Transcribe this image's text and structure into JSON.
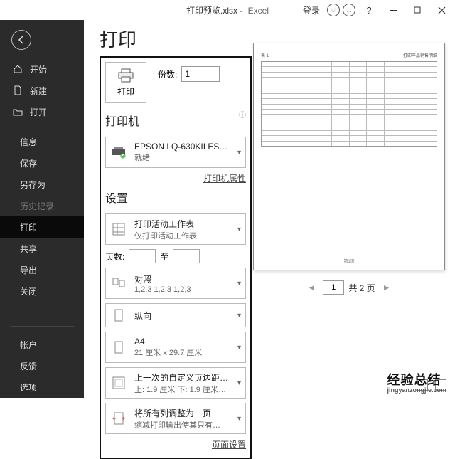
{
  "titlebar": {
    "filename": "打印预览.xlsx",
    "sep": " - ",
    "app": "Excel",
    "login": "登录"
  },
  "sidebar": {
    "home": "开始",
    "new": "新建",
    "open": "打开",
    "info": "信息",
    "save": "保存",
    "saveas": "另存为",
    "history": "历史记录",
    "print": "打印",
    "share": "共享",
    "export": "导出",
    "close": "关闭",
    "account": "帐户",
    "feedback": "反馈",
    "options": "选项"
  },
  "page": {
    "title": "打印"
  },
  "printbtn": {
    "label": "打印",
    "copies_label": "份数:",
    "copies_value": "1"
  },
  "printer": {
    "section": "打印机",
    "name": "EPSON LQ-630KII ESC…",
    "status": "就绪",
    "props": "打印机属性"
  },
  "settings": {
    "section": "设置",
    "active": {
      "t1": "打印活动工作表",
      "t2": "仅打印活动工作表"
    },
    "pages_label": "页数:",
    "pages_to": "至",
    "collate": {
      "t1": "对照",
      "t2": "1,2,3   1,2,3   1,2,3"
    },
    "orient": {
      "t1": "纵向"
    },
    "paper": {
      "t1": "A4",
      "t2": "21 厘米 x 29.7 厘米"
    },
    "margins": {
      "t1": "上一次的自定义页边距…",
      "t2": "上: 1.9 厘米 下: 1.9 厘米…"
    },
    "scale": {
      "t1": "将所有列调整为一页",
      "t2": "缩减打印输出使其只有…"
    },
    "pagesetup": "页面设置"
  },
  "preview": {
    "hdr_left": "表 1",
    "hdr_right": "打印产品销售明细",
    "footer": "第1页"
  },
  "pager": {
    "value": "1",
    "total": "共 2 页"
  },
  "watermark": {
    "t1": "经验总结",
    "t2": "jingyanzongjie.com"
  }
}
